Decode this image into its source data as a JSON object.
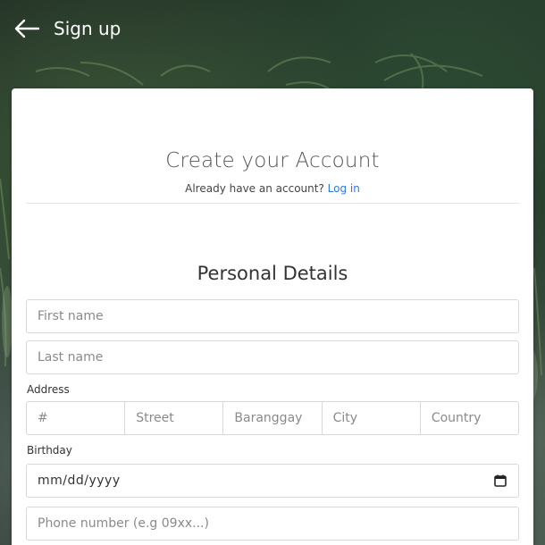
{
  "header": {
    "title": "Sign up",
    "back_icon": "arrow-left-icon"
  },
  "card": {
    "title": "Create your Account",
    "login_prompt": "Already have an account?",
    "login_link": "Log in"
  },
  "personal": {
    "section_title": "Personal Details",
    "first_name_placeholder": "First name",
    "last_name_placeholder": "Last name",
    "address_label": "Address",
    "address_fields": {
      "number": "#",
      "street": "Street",
      "barangay": "Baranggay",
      "city": "City",
      "country": "Country"
    },
    "birthday_label": "Birthday",
    "birthday_value": "mm/dd/yyyy",
    "calendar_icon": "calendar-icon",
    "phone_placeholder": "Phone number (e.g 09xx...)"
  },
  "colors": {
    "link": "#2f7ad8",
    "card_bg": "#ffffff",
    "header_text": "#ffffff"
  }
}
